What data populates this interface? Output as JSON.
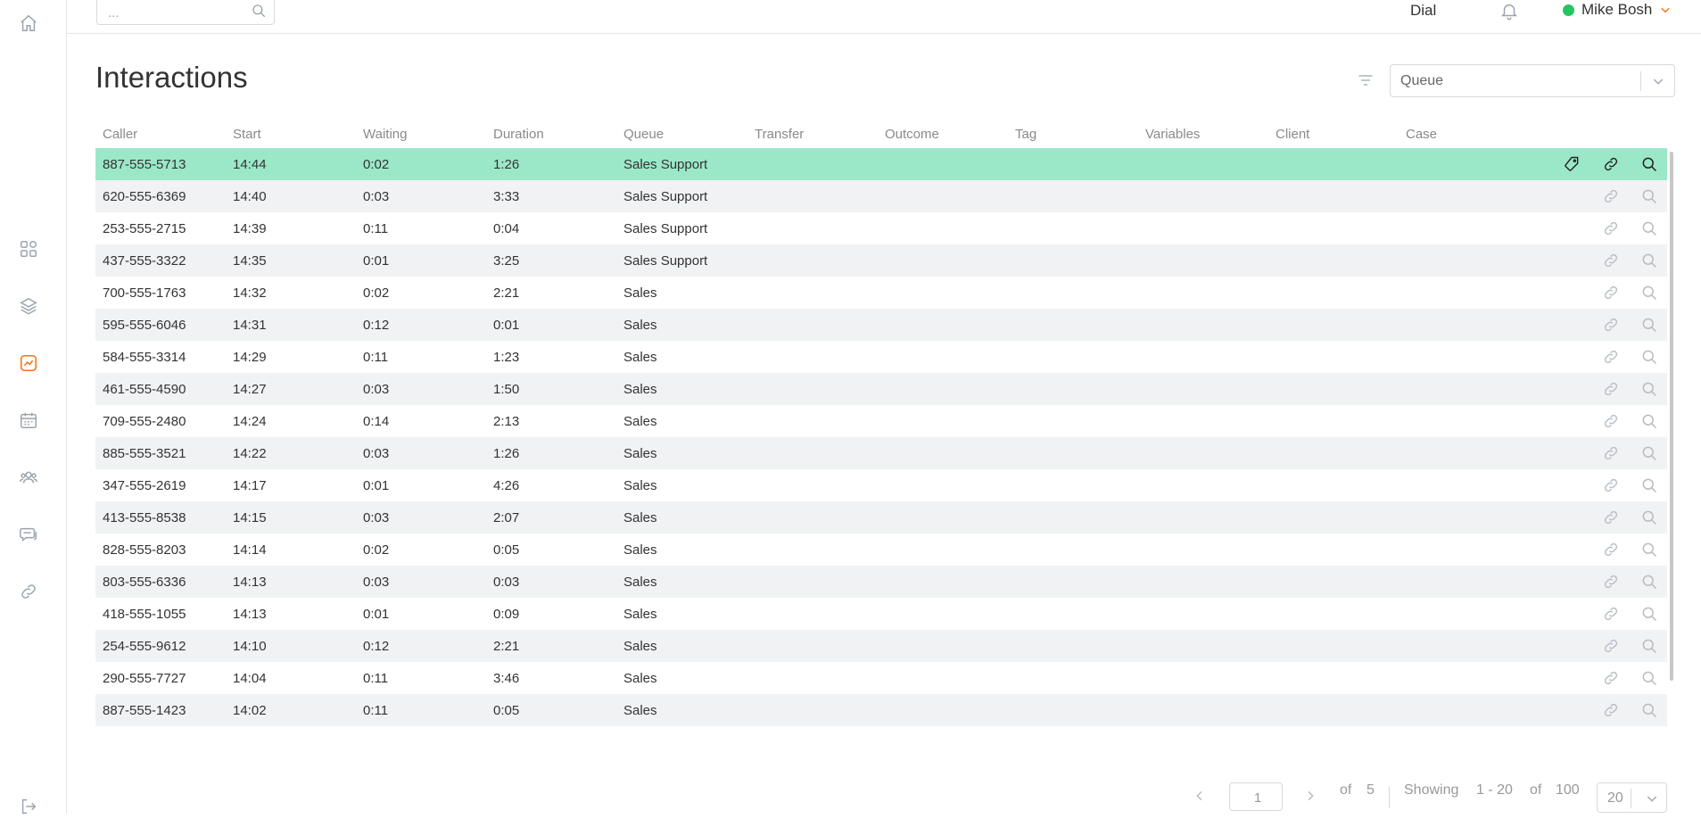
{
  "colors": {
    "accent": "#f97316",
    "selected_row": "#9be8c8",
    "online": "#22c55e",
    "icon_gray": "#9aa3ad"
  },
  "sidebar": {
    "items": [
      {
        "name": "home-icon"
      },
      {
        "name": "dashboard-icon"
      },
      {
        "name": "layers-icon"
      },
      {
        "name": "analytics-icon",
        "active": true
      },
      {
        "name": "calendar-icon"
      },
      {
        "name": "users-icon"
      },
      {
        "name": "chat-icon"
      },
      {
        "name": "link-icon"
      },
      {
        "name": "logout-icon"
      }
    ]
  },
  "topbar": {
    "search_placeholder": "...",
    "dial_label": "Dial",
    "user_name": "Mike Bosh"
  },
  "page": {
    "title": "Interactions",
    "queue_placeholder": "Queue"
  },
  "table": {
    "columns": [
      "Caller",
      "Start",
      "Waiting",
      "Duration",
      "Queue",
      "Transfer",
      "Outcome",
      "Tag",
      "Variables",
      "Client",
      "Case"
    ],
    "rows": [
      [
        "887-555-5713",
        "14:44",
        "0:02",
        "1:26",
        "Sales Support"
      ],
      [
        "620-555-6369",
        "14:40",
        "0:03",
        "3:33",
        "Sales Support"
      ],
      [
        "253-555-2715",
        "14:39",
        "0:11",
        "0:04",
        "Sales Support"
      ],
      [
        "437-555-3322",
        "14:35",
        "0:01",
        "3:25",
        "Sales Support"
      ],
      [
        "700-555-1763",
        "14:32",
        "0:02",
        "2:21",
        "Sales"
      ],
      [
        "595-555-6046",
        "14:31",
        "0:12",
        "0:01",
        "Sales"
      ],
      [
        "584-555-3314",
        "14:29",
        "0:11",
        "1:23",
        "Sales"
      ],
      [
        "461-555-4590",
        "14:27",
        "0:03",
        "1:50",
        "Sales"
      ],
      [
        "709-555-2480",
        "14:24",
        "0:14",
        "2:13",
        "Sales"
      ],
      [
        "885-555-3521",
        "14:22",
        "0:03",
        "1:26",
        "Sales"
      ],
      [
        "347-555-2619",
        "14:17",
        "0:01",
        "4:26",
        "Sales"
      ],
      [
        "413-555-8538",
        "14:15",
        "0:03",
        "2:07",
        "Sales"
      ],
      [
        "828-555-8203",
        "14:14",
        "0:02",
        "0:05",
        "Sales"
      ],
      [
        "803-555-6336",
        "14:13",
        "0:03",
        "0:03",
        "Sales"
      ],
      [
        "418-555-1055",
        "14:13",
        "0:01",
        "0:09",
        "Sales"
      ],
      [
        "254-555-9612",
        "14:10",
        "0:12",
        "2:21",
        "Sales"
      ],
      [
        "290-555-7727",
        "14:04",
        "0:11",
        "3:46",
        "Sales"
      ],
      [
        "887-555-1423",
        "14:02",
        "0:11",
        "0:05",
        "Sales"
      ]
    ],
    "selected_row": 0
  },
  "pagination": {
    "current_page": "1",
    "of_label": "of",
    "total_pages": "5",
    "showing_label": "Showing",
    "range": "1 - 20",
    "of_label2": "of",
    "total_items": "100",
    "page_size": "20"
  }
}
